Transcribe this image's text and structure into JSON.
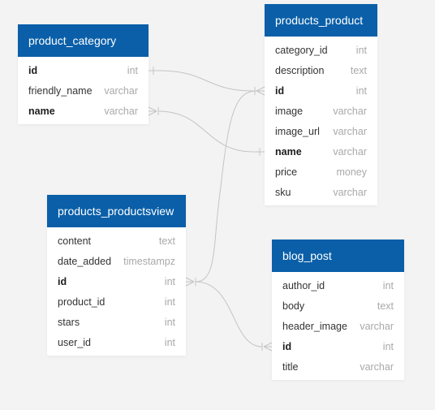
{
  "tables": [
    {
      "name": "product_category",
      "fields": [
        {
          "name": "id",
          "type": "int",
          "key": true
        },
        {
          "name": "friendly_name",
          "type": "varchar",
          "key": false
        },
        {
          "name": "name",
          "type": "varchar",
          "key": true
        }
      ]
    },
    {
      "name": "products_product",
      "fields": [
        {
          "name": "category_id",
          "type": "int",
          "key": false
        },
        {
          "name": "description",
          "type": "text",
          "key": false
        },
        {
          "name": "id",
          "type": "int",
          "key": true
        },
        {
          "name": "image",
          "type": "varchar",
          "key": false
        },
        {
          "name": "image_url",
          "type": "varchar",
          "key": false
        },
        {
          "name": "name",
          "type": "varchar",
          "key": true
        },
        {
          "name": "price",
          "type": "money",
          "key": false
        },
        {
          "name": "sku",
          "type": "varchar",
          "key": false
        }
      ]
    },
    {
      "name": "products_productsview",
      "fields": [
        {
          "name": "content",
          "type": "text",
          "key": false
        },
        {
          "name": "date_added",
          "type": "timestampz",
          "key": false
        },
        {
          "name": "id",
          "type": "int",
          "key": true
        },
        {
          "name": "product_id",
          "type": "int",
          "key": false
        },
        {
          "name": "stars",
          "type": "int",
          "key": false
        },
        {
          "name": "user_id",
          "type": "int",
          "key": false
        }
      ]
    },
    {
      "name": "blog_post",
      "fields": [
        {
          "name": "author_id",
          "type": "int",
          "key": false
        },
        {
          "name": "body",
          "type": "text",
          "key": false
        },
        {
          "name": "header_image",
          "type": "varchar",
          "key": false
        },
        {
          "name": "id",
          "type": "int",
          "key": true
        },
        {
          "name": "title",
          "type": "varchar",
          "key": false
        }
      ]
    }
  ],
  "relationships": [
    {
      "from_table": "product_category",
      "from_field": "id",
      "from_end": "one",
      "to_table": "products_product",
      "to_field": "id",
      "to_end": "many"
    },
    {
      "from_table": "product_category",
      "from_field": "name",
      "from_end": "many",
      "to_table": "products_product",
      "to_field": "name",
      "to_end": "one"
    },
    {
      "from_table": "products_productsview",
      "from_field": "id",
      "from_end": "many",
      "to_table": "products_product",
      "to_field": "id",
      "to_end": "one"
    },
    {
      "from_table": "products_productsview",
      "from_field": "id",
      "from_end": "many",
      "to_table": "blog_post",
      "to_field": "id",
      "to_end": "many"
    }
  ],
  "colors": {
    "header": "#0a5fa8",
    "connector": "#c4c4c4",
    "background": "#f3f3f3"
  }
}
